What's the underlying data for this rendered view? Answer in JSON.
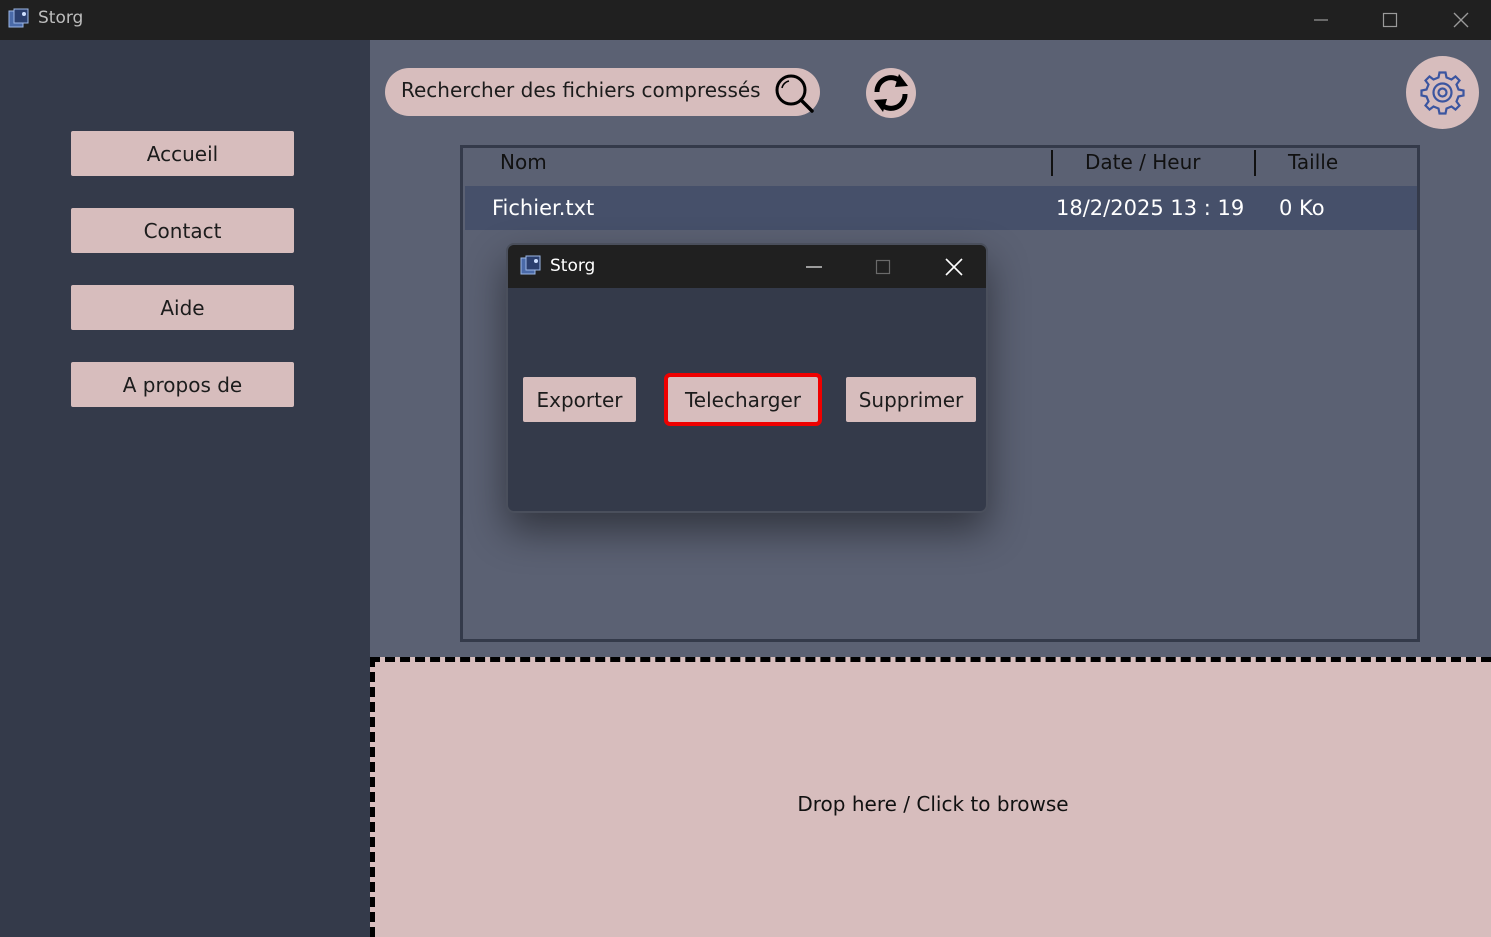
{
  "window": {
    "title": "Storg"
  },
  "sidebar": {
    "items": [
      {
        "label": "Accueil"
      },
      {
        "label": "Contact"
      },
      {
        "label": "Aide"
      },
      {
        "label": "A propos de"
      }
    ]
  },
  "toolbar": {
    "search_label": "Rechercher des fichiers compressés"
  },
  "table": {
    "columns": [
      "Nom",
      "Date / Heur",
      "Taille"
    ],
    "rows": [
      {
        "name": "Fichier.txt",
        "date": "18/2/2025 13 : 19",
        "size": "0 Ko"
      }
    ]
  },
  "dropzone": {
    "label": "Drop here / Click to browse"
  },
  "dialog": {
    "title": "Storg",
    "buttons": [
      {
        "label": "Exporter"
      },
      {
        "label": "Telecharger",
        "highlighted": true
      },
      {
        "label": "Supprimer"
      }
    ]
  },
  "colors": {
    "sidebar_bg": "#343a4a",
    "main_bg": "#5b6173",
    "button_bg": "#d7bdbd",
    "selected_row": "#46506a",
    "titlebar": "#202020",
    "highlight": "#ee0000"
  },
  "icons": [
    "app-icon",
    "search-icon",
    "refresh-icon",
    "gear-icon",
    "minimize-icon",
    "maximize-icon",
    "close-icon"
  ]
}
